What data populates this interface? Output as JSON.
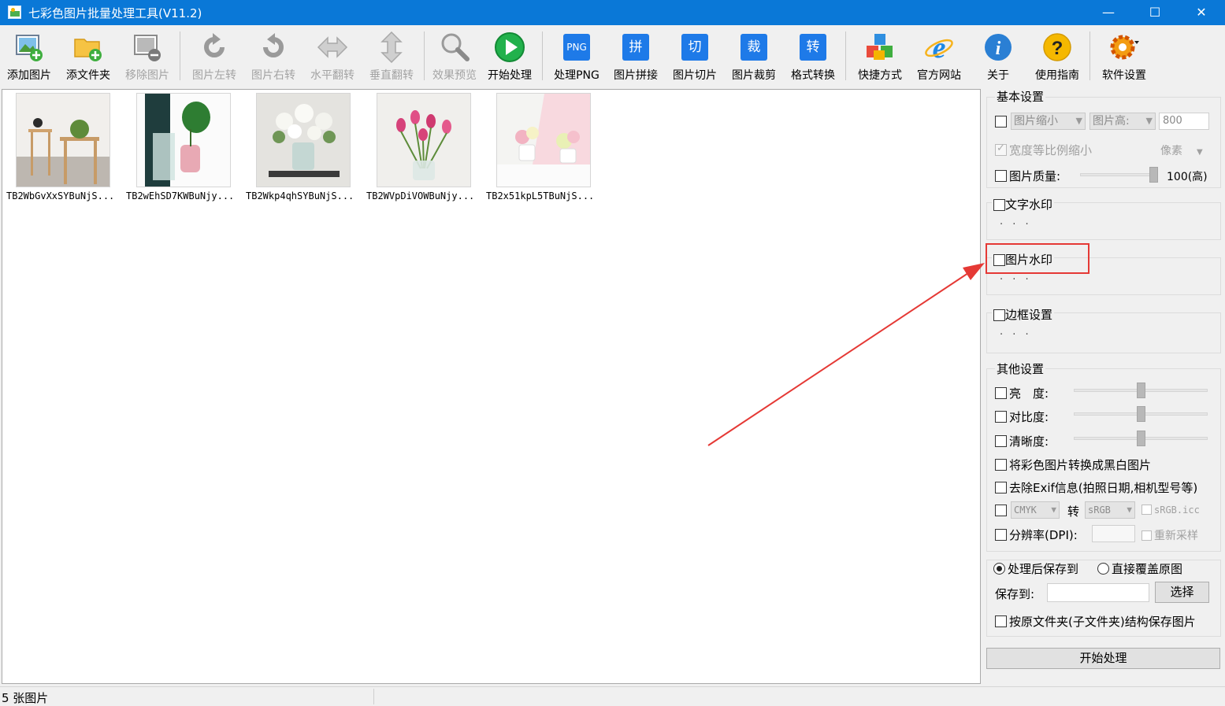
{
  "window": {
    "title": "七彩色图片批量处理工具(V11.2)",
    "minimize": "—",
    "maximize": "☐",
    "close": "✕"
  },
  "toolbar": {
    "add_image": "添加图片",
    "add_folder": "添文件夹",
    "remove_image": "移除图片",
    "rotate_left": "图片左转",
    "rotate_right": "图片右转",
    "flip_horizontal": "水平翻转",
    "flip_vertical": "垂直翻转",
    "preview": "效果预览",
    "start": "开始处理",
    "process_png": "处理PNG",
    "png_badge": "PNG",
    "stitch": "图片拼接",
    "stitch_badge": "拼",
    "slice": "图片切片",
    "slice_badge": "切",
    "crop": "图片裁剪",
    "crop_badge": "裁",
    "convert": "格式转换",
    "convert_badge": "转",
    "shortcut": "快捷方式",
    "website": "官方网站",
    "about": "关于",
    "guide": "使用指南",
    "settings": "软件设置",
    "accent": "#1e7ae8"
  },
  "images": [
    {
      "name": "TB2WbGvXxSYBuNjS..."
    },
    {
      "name": "TB2wEhSD7KWBuNjy..."
    },
    {
      "name": "TB2Wkp4qhSYBuNjS..."
    },
    {
      "name": "TB2WVpDiVOWBuNjy..."
    },
    {
      "name": "TB2x51kpL5TBuNjS..."
    }
  ],
  "basic": {
    "title": "基本设置",
    "resize_mode": "图片缩小",
    "dimension": "图片高:",
    "size_value": "800",
    "keep_ratio": "宽度等比例缩小",
    "unit": "像素",
    "quality_label": "图片质量:",
    "quality_value": "100(高)",
    "quality_level": 100
  },
  "text_watermark": {
    "title": "文字水印",
    "more": "· · ·"
  },
  "image_watermark": {
    "title": "图片水印",
    "more": "· · ·"
  },
  "border": {
    "title": "边框设置",
    "more": "· · ·"
  },
  "other": {
    "title": "其他设置",
    "brightness": "亮　度:",
    "contrast": "对比度:",
    "sharpness": "清晰度:",
    "grayscale": "将彩色图片转换成黑白图片",
    "remove_exif": "去除Exif信息(拍照日期,相机型号等)",
    "color_from": "CMYK",
    "to": "转",
    "color_to": "sRGB",
    "icc": "sRGB.icc",
    "dpi_label": "分辨率(DPI):",
    "resample": "重新采样"
  },
  "save": {
    "save_to_option": "处理后保存到",
    "overwrite_option": "直接覆盖原图",
    "save_to_label": "保存到:",
    "choose": "选择",
    "keep_structure": "按原文件夹(子文件夹)结构保存图片"
  },
  "start_button": "开始处理",
  "status": {
    "count": "5 张图片"
  }
}
